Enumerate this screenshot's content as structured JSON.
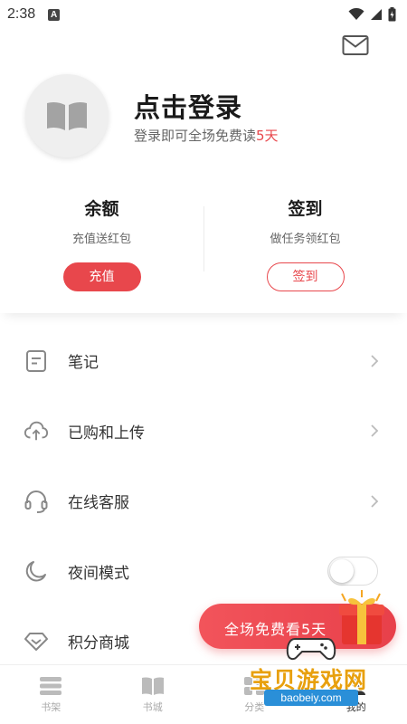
{
  "status_bar": {
    "time": "2:38",
    "notification_letter": "A"
  },
  "header": {
    "mail_icon": "mail-icon",
    "avatar_icon": "book-open-icon",
    "login_title": "点击登录",
    "login_subtitle_prefix": "登录即可全场免费读",
    "login_subtitle_highlight": "5天"
  },
  "balance": {
    "left": {
      "title": "余额",
      "subtitle": "充值送红包",
      "button": "充值"
    },
    "right": {
      "title": "签到",
      "subtitle": "做任务领红包",
      "button": "签到"
    }
  },
  "menu": {
    "items": [
      {
        "label": "笔记",
        "icon": "note-icon"
      },
      {
        "label": "已购和上传",
        "icon": "cloud-upload-icon"
      },
      {
        "label": "在线客服",
        "icon": "headset-icon"
      },
      {
        "label": "夜间模式",
        "icon": "moon-icon",
        "toggle": false
      },
      {
        "label": "积分商城",
        "icon": "diamond-icon"
      }
    ]
  },
  "promo": {
    "text": "全场免费看5天",
    "icon": "gift-icon"
  },
  "tabbar": {
    "tabs": [
      {
        "label": "书架",
        "icon": "bookshelf-icon"
      },
      {
        "label": "书城",
        "icon": "book-icon"
      },
      {
        "label": "分类",
        "icon": "category-icon"
      },
      {
        "label": "我的",
        "icon": "profile-icon",
        "active": true
      }
    ]
  },
  "watermark": {
    "title": "宝贝游戏网",
    "url": "baobeiy.com"
  },
  "colors": {
    "accent": "#e8474c",
    "text_primary": "#1a1a1a",
    "text_secondary": "#666666",
    "icon_gray": "#888888"
  }
}
